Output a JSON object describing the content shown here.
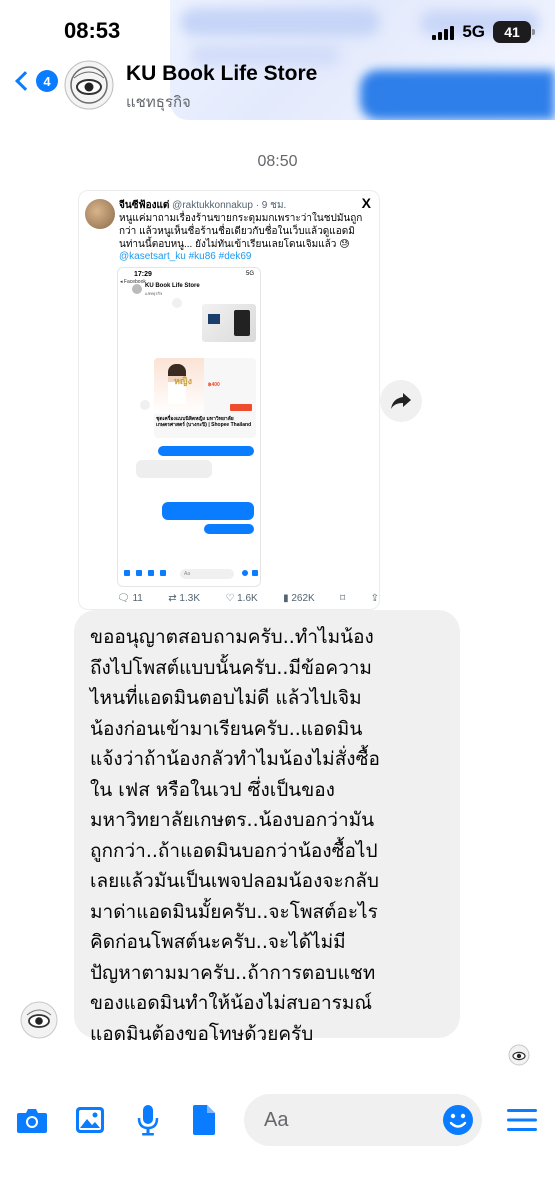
{
  "status_bar": {
    "time": "08:53",
    "network": "5G",
    "battery": "41"
  },
  "header": {
    "back_count": "4",
    "title": "KU Book Life Store",
    "subtitle": "แชทธุรกิจ"
  },
  "thread": {
    "timestamp": "08:50"
  },
  "shared_post": {
    "author_name": "จีนซีฟ้องแต่",
    "author_handle": "@raktukkonnakup · 9 ชม.",
    "platform_icon": "X",
    "text": "หนูแค่มาถามเรื่องร้านขายกระดุมมกเพราะว่าในชปมันถูกกว่า แล้วหนูเห็นชื่อร้านชื่อเดียวกับชื่อในเว็บแล้วดูแอดมิ นท่านนี้ตอบหนู... ยังไม่ทันเข้าเรียนเลยโดนเจิมแล้ว 😓",
    "tags": "@kasetsart_ku #ku86 #dek69",
    "screenshot": {
      "time": "17:29",
      "status": "5G",
      "back": "◂ Facebook",
      "title": "KU Book Life Store",
      "subtitle": "แชทธุรกิจ",
      "product_label": "หญิง",
      "product_price": "฿400",
      "product_title": "ชุดเครื่องแบบนิสิตหญิง มหาวิทยาลัยเกษตรศาสตร์ (บางกะปิ) | Shopee Thailand",
      "input_placeholder": "Aa"
    },
    "stats": {
      "replies": "11",
      "reposts": "1.3K",
      "likes": "1.6K",
      "views": "262K"
    }
  },
  "message": {
    "lines": [
      "ขออนุญาตสอบถามครับ..ทำไมน้อง",
      "ถึงไปโพสต์แบบนั้นครับ..มีข้อความ",
      "ไหนที่แอดมินตอบไม่ดี แล้วไปเจิม",
      "น้องก่อนเข้ามาเรียนครับ..แอดมิน",
      "แจ้งว่าถ้าน้องกลัวทำไมน้องไม่สั่งซื้อ",
      "ใน เฟส หรือในเวป ซึ่งเป็นของ",
      "มหาวิทยาลัยเกษตร..น้องบอกว่ามัน",
      "ถูกกว่า..ถ้าแอดมินบอกว่าน้องซื้อไป",
      "เลยแล้วมันเป็นเพจปลอมน้องจะกลับ",
      "มาด่าแอดมินมั้ยครับ..จะโพสต์อะไร",
      "คิดก่อนโพสต์นะครับ..จะได้ไม่มี",
      "ปัญหาตามมาครับ..ถ้าการตอบแชท",
      "ของแอดมินทำให้น้องไม่สบอารมณ์",
      "แอดมินต้องขอโทษด้วยครับ"
    ]
  },
  "composer": {
    "placeholder": "Aa",
    "icons": [
      "camera-icon",
      "image-icon",
      "microphone-icon",
      "document-icon",
      "emoji-icon",
      "menu-icon"
    ]
  },
  "colors": {
    "accent": "#0a7cff",
    "bubble": "#f0f0f0",
    "secondary_text": "#65676b"
  }
}
